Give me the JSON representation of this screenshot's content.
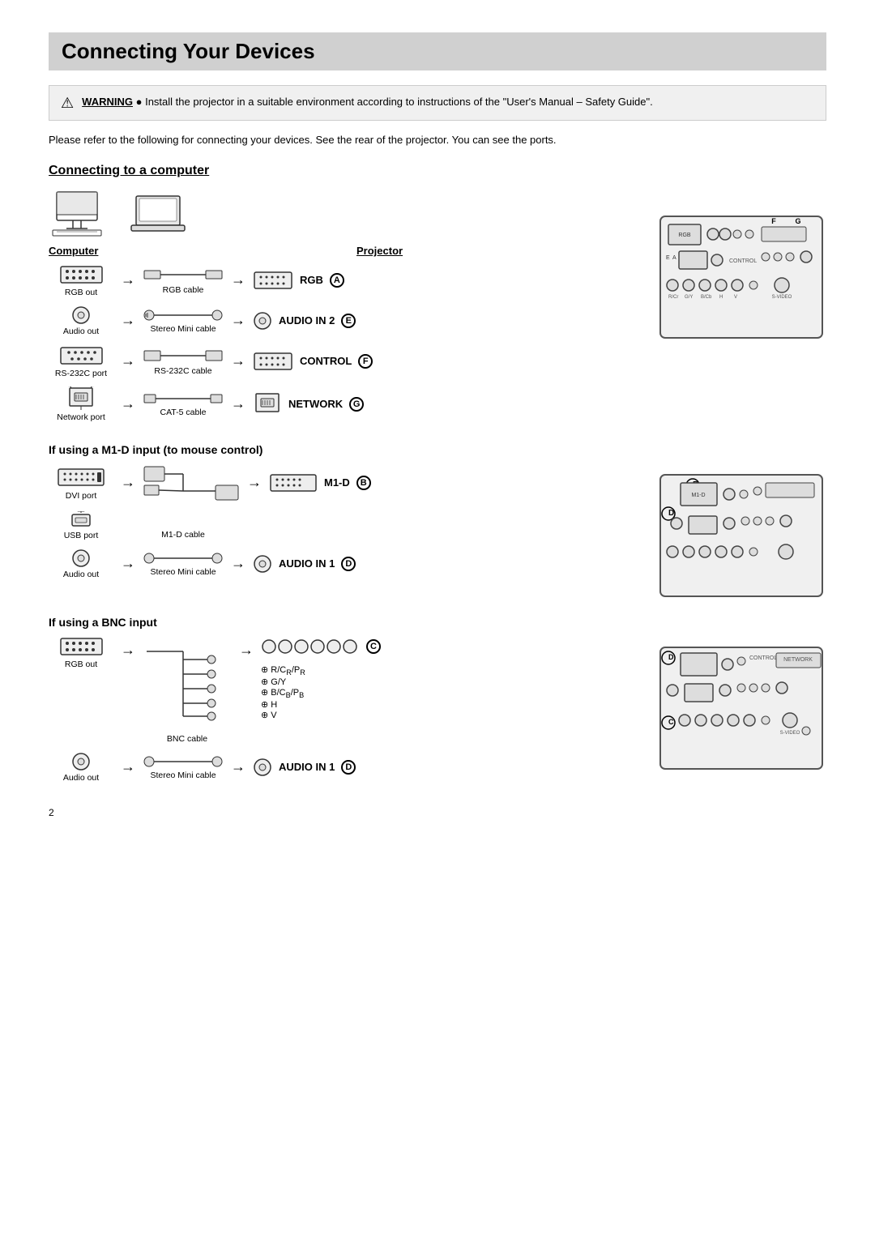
{
  "page": {
    "title": "Connecting Your Devices",
    "warning_label": "WARNING",
    "warning_text": "Install the projector in a suitable environment according to instructions of the \"User's Manual – Safety Guide\".",
    "intro": "Please refer to the following for connecting your devices. See the rear of the projector. You can see the ports.",
    "section1_heading": "Connecting to a computer",
    "col_computer": "Computer",
    "col_projector": "Projector",
    "connections_computer": [
      {
        "port_label": "RGB out",
        "cable_label": "RGB cable",
        "proj_label": "RGB",
        "badge": "A"
      },
      {
        "port_label": "Audio out",
        "cable_label": "Stereo Mini cable",
        "proj_label": "AUDIO IN 2",
        "badge": "E"
      },
      {
        "port_label": "RS-232C port",
        "cable_label": "RS-232C cable",
        "proj_label": "CONTROL",
        "badge": "F"
      },
      {
        "port_label": "Network port",
        "cable_label": "CAT-5 cable",
        "proj_label": "NETWORK",
        "badge": "G"
      }
    ],
    "section2_heading": "If using a M1-D input (to mouse control)",
    "connections_m1d": [
      {
        "port_label": "DVI port",
        "cable_label": "",
        "proj_label": "M1-D",
        "badge": "B"
      },
      {
        "port_label": "USB port",
        "cable_label": "M1-D cable",
        "proj_label": "",
        "badge": ""
      },
      {
        "port_label": "Audio out",
        "cable_label": "Stereo Mini cable",
        "proj_label": "AUDIO IN 1",
        "badge": "D"
      }
    ],
    "section3_heading": "If using a BNC input",
    "connections_bnc": [
      {
        "port_label": "RGB out",
        "cable_label": "BNC cable",
        "proj_label_lines": [
          "R/CR/PR",
          "G/Y",
          "B/CB/PB",
          "H",
          "V"
        ],
        "proj_label": "C",
        "badge": "C"
      },
      {
        "port_label": "Audio out",
        "cable_label": "Stereo Mini cable",
        "proj_label": "AUDIO IN 1",
        "badge": "D"
      }
    ],
    "page_number": "2"
  }
}
